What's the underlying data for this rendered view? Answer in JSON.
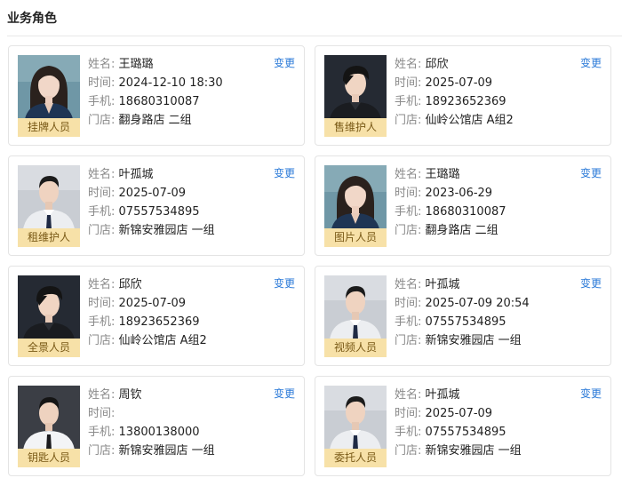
{
  "section": {
    "title": "业务角色"
  },
  "labels": {
    "name": "姓名:",
    "time": "时间:",
    "phone": "手机:",
    "store": "门店:",
    "change": "变更"
  },
  "colors": {
    "accent": "#2b7ad8",
    "badge_bg": "#f7e1a8",
    "badge_text": "#7a5a17"
  },
  "cards": [
    {
      "role": "挂牌人员",
      "name": "王璐璐",
      "time": "2024-12-10 18:30",
      "phone": "18680310087",
      "store": "翻身路店 二组",
      "avatar": "female-teal"
    },
    {
      "role": "售维护人",
      "name": "邱欣",
      "time": "2025-07-09",
      "phone": "18923652369",
      "store": "仙岭公馆店 A组2",
      "avatar": "male-dark"
    },
    {
      "role": "租维护人",
      "name": "叶孤城",
      "time": "2025-07-09",
      "phone": "07557534895",
      "store": "新锦安雅园店 一组",
      "avatar": "male-suit"
    },
    {
      "role": "图片人员",
      "name": "王璐璐",
      "time": "2023-06-29",
      "phone": "18680310087",
      "store": "翻身路店 二组",
      "avatar": "female-teal"
    },
    {
      "role": "全景人员",
      "name": "邱欣",
      "time": "2025-07-09",
      "phone": "18923652369",
      "store": "仙岭公馆店 A组2",
      "avatar": "male-dark"
    },
    {
      "role": "视频人员",
      "name": "叶孤城",
      "time": "2025-07-09 20:54",
      "phone": "07557534895",
      "store": "新锦安雅园店 一组",
      "avatar": "male-suit"
    },
    {
      "role": "钥匙人员",
      "name": "周钦",
      "time": "",
      "phone": "13800138000",
      "store": "新锦安雅园店 一组",
      "avatar": "male-shirt"
    },
    {
      "role": "委托人员",
      "name": "叶孤城",
      "time": "2025-07-09",
      "phone": "07557534895",
      "store": "新锦安雅园店 一组",
      "avatar": "male-suit"
    }
  ]
}
